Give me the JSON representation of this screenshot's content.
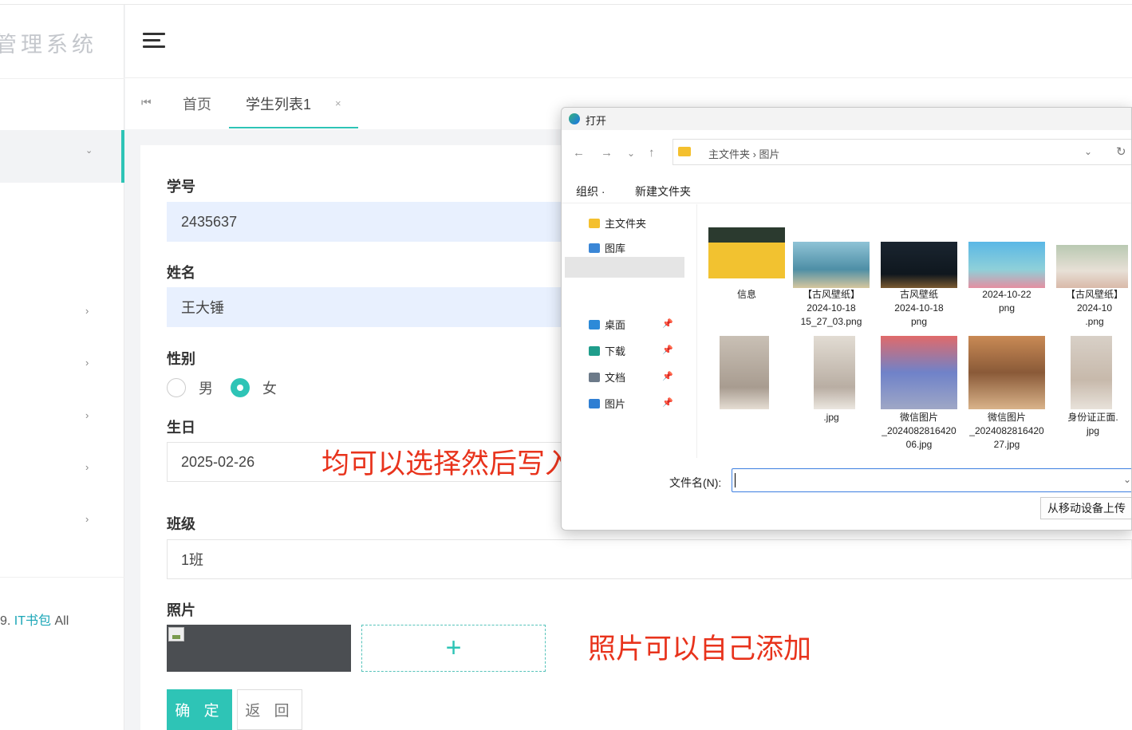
{
  "app": {
    "logo_text": "管理系统"
  },
  "sidebar": {
    "footer_prefix": "9. ",
    "footer_brand": "IT书包",
    "footer_suffix": " All"
  },
  "tabs": {
    "home": "首页",
    "active": "学生列表1",
    "close": "×"
  },
  "form": {
    "student_id_label": "学号",
    "student_id_value": "2435637",
    "name_label": "姓名",
    "name_value": "王大锤",
    "gender_label": "性别",
    "gender_options": [
      "男",
      "女"
    ],
    "gender_selected": "女",
    "birthday_label": "生日",
    "birthday_value": "2025-02-26",
    "class_label": "班级",
    "class_value": "1班",
    "photo_label": "照片",
    "add_photo": "+",
    "confirm_button": "确 定",
    "back_button": "返 回"
  },
  "annotations": {
    "select_info": "均可以选择然后写入信息",
    "photo_add": "照片可以自己添加",
    "color": "#e8331c"
  },
  "file_dialog": {
    "title": "打开",
    "path_text": "主文件夹 › 图片",
    "toolbar": {
      "organize": "组织 ·",
      "new_folder": "新建文件夹"
    },
    "sidebar_items": [
      {
        "label": "主文件夹"
      },
      {
        "label": "图库"
      },
      {
        "label": "桌面"
      },
      {
        "label": "下载"
      },
      {
        "label": "文档"
      },
      {
        "label": "图片"
      }
    ],
    "files": [
      {
        "line1": "信息",
        "line2": "",
        "line3": ""
      },
      {
        "line1": "【古风壁纸】",
        "line2": "2024-10-18",
        "line3": "15_27_03.png"
      },
      {
        "line1": "古风壁纸",
        "line2": "2024-10-18",
        "line3": "png"
      },
      {
        "line1": "",
        "line2": "2024-10-22",
        "line3": "png"
      },
      {
        "line1": "【古风壁纸】",
        "line2": "2024-10",
        "line3": ".png"
      },
      {
        "line1": "",
        "line2": "",
        "line3": ""
      },
      {
        "line1": "",
        "line2": "",
        "line3": ".jpg"
      },
      {
        "line1": "微信图片",
        "line2": "_2024082816420",
        "line3": "06.jpg"
      },
      {
        "line1": "微信图片",
        "line2": "_2024082816420",
        "line3": "27.jpg"
      },
      {
        "line1": "身份证正面.",
        "line2": "jpg",
        "line3": ""
      }
    ],
    "filename_label": "文件名(N):",
    "filename_value": "",
    "upload_button": "从移动设备上传"
  },
  "colors": {
    "accent": "#2ec4b6",
    "input_filled_bg": "#e8f0fe",
    "annotation": "#e8331c"
  }
}
